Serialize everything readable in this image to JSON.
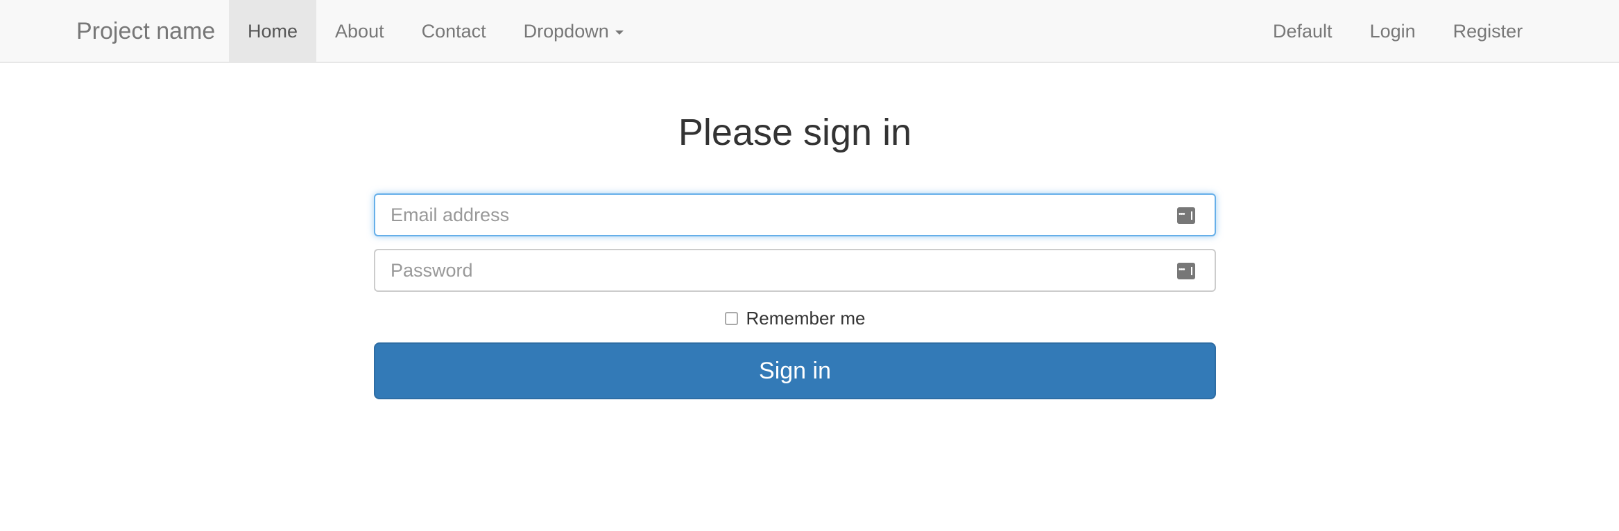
{
  "navbar": {
    "brand": "Project name",
    "left_items": [
      {
        "label": "Home",
        "active": true
      },
      {
        "label": "About"
      },
      {
        "label": "Contact"
      },
      {
        "label": "Dropdown",
        "has_caret": true
      }
    ],
    "right_items": [
      {
        "label": "Default"
      },
      {
        "label": "Login"
      },
      {
        "label": "Register"
      }
    ]
  },
  "form": {
    "title": "Please sign in",
    "email": {
      "placeholder": "Email address",
      "value": "",
      "icon": "password-manager-key-icon",
      "focused": true
    },
    "password": {
      "placeholder": "Password",
      "value": "",
      "icon": "password-manager-key-icon"
    },
    "remember": {
      "label": "Remember me",
      "checked": false
    },
    "submit_label": "Sign in"
  },
  "colors": {
    "navbar_bg": "#f8f8f8",
    "active_nav_bg": "#e7e7e7",
    "primary": "#337ab7",
    "focus_border": "#66afe9"
  }
}
